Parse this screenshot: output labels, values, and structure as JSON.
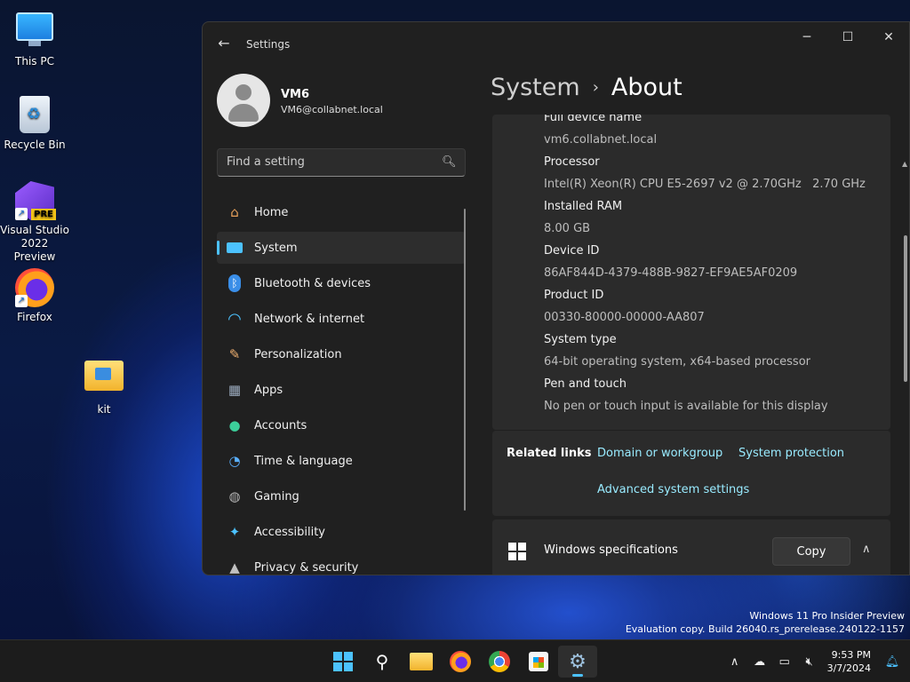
{
  "desktop": {
    "icons": [
      {
        "label": "This PC"
      },
      {
        "label": "Recycle Bin"
      },
      {
        "label": "Visual Studio\n2022 Preview",
        "line1": "Visual Studio",
        "line2": "2022 Preview",
        "badge": "PRE"
      },
      {
        "label": "Firefox"
      },
      {
        "label": "kit"
      }
    ],
    "watermark": {
      "line1": "Windows 11 Pro Insider Preview",
      "line2": "Evaluation copy. Build 26040.rs_prerelease.240122-1157"
    }
  },
  "window": {
    "title": "Settings",
    "controls": {
      "minimize": "─",
      "maximize": "☐",
      "close": "✕"
    },
    "user": {
      "name": "VM6",
      "email": "VM6@collabnet.local"
    },
    "search": {
      "placeholder": "Find a setting"
    },
    "nav": [
      {
        "label": "Home",
        "icon": "home-icon",
        "glyph": "⌂",
        "color": "#e8a15a"
      },
      {
        "label": "System",
        "icon": "system-icon",
        "glyph": "▭",
        "color": "#4cc2ff",
        "active": true
      },
      {
        "label": "Bluetooth & devices",
        "icon": "bluetooth-icon",
        "glyph": "ᛒ",
        "color": "#4ca6ff"
      },
      {
        "label": "Network & internet",
        "icon": "wifi-icon",
        "glyph": "◠",
        "color": "#4cc2ff"
      },
      {
        "label": "Personalization",
        "icon": "brush-icon",
        "glyph": "✎",
        "color": "#f0b070"
      },
      {
        "label": "Apps",
        "icon": "apps-icon",
        "glyph": "▦",
        "color": "#9aa9bc"
      },
      {
        "label": "Accounts",
        "icon": "accounts-icon",
        "glyph": "●",
        "color": "#3ccf9a"
      },
      {
        "label": "Time & language",
        "icon": "clock-globe-icon",
        "glyph": "◔",
        "color": "#5ab0ff"
      },
      {
        "label": "Gaming",
        "icon": "gamepad-icon",
        "glyph": "◍",
        "color": "#b0b0b0"
      },
      {
        "label": "Accessibility",
        "icon": "accessibility-icon",
        "glyph": "✦",
        "color": "#4cc2ff"
      },
      {
        "label": "Privacy & security",
        "icon": "shield-icon",
        "glyph": "▲",
        "color": "#c0c0c0"
      }
    ],
    "breadcrumb": {
      "parent": "System",
      "separator": "›",
      "current": "About"
    },
    "device_specs": [
      {
        "label": "Full device name",
        "value": "vm6.collabnet.local"
      },
      {
        "label": "Processor",
        "value": "Intel(R) Xeon(R) CPU E5-2697 v2 @ 2.70GHz   2.70 GHz"
      },
      {
        "label": "Installed RAM",
        "value": "8.00 GB"
      },
      {
        "label": "Device ID",
        "value": "86AF844D-4379-488B-9827-EF9AE5AF0209"
      },
      {
        "label": "Product ID",
        "value": "00330-80000-00000-AA807"
      },
      {
        "label": "System type",
        "value": "64-bit operating system, x64-based processor"
      },
      {
        "label": "Pen and touch",
        "value": "No pen or touch input is available for this display"
      }
    ],
    "related_links": {
      "title": "Related links",
      "links": [
        "Domain or workgroup",
        "System protection",
        "Advanced system settings"
      ]
    },
    "windows_specifications": {
      "title": "Windows specifications",
      "copy_label": "Copy"
    }
  },
  "taskbar": {
    "apps": [
      "start-icon",
      "search-icon",
      "file-explorer-icon",
      "firefox-icon",
      "chrome-icon",
      "store-icon",
      "settings-icon"
    ],
    "clock": {
      "time": "9:53 PM",
      "date": "3/7/2024"
    }
  }
}
